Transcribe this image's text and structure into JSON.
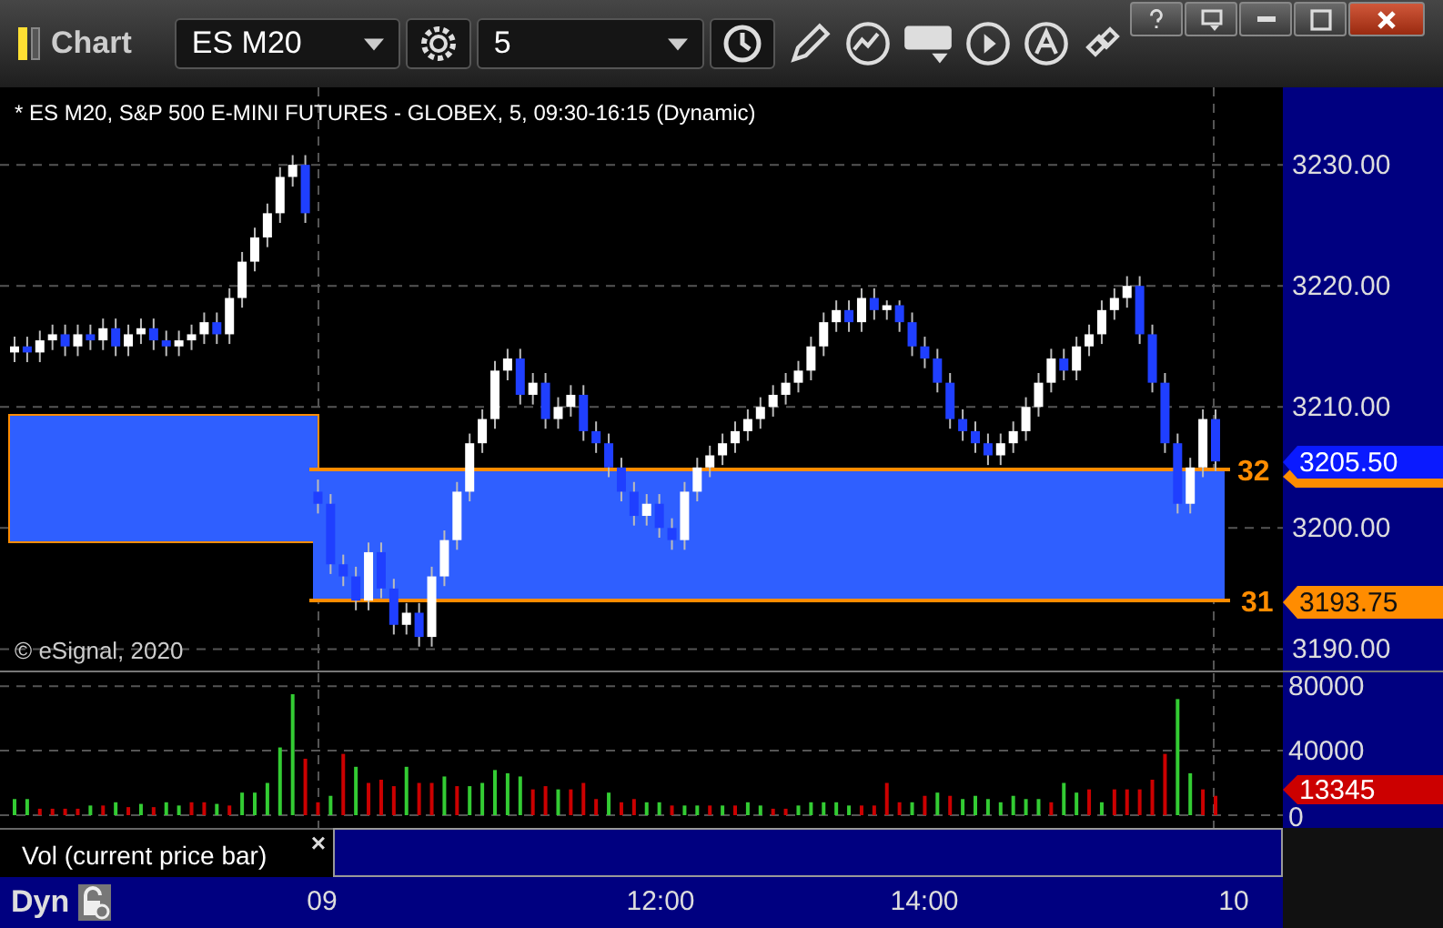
{
  "window": {
    "title": "Chart"
  },
  "toolbar": {
    "symbol": "ES M20",
    "interval": "5"
  },
  "price_pane": {
    "info": "* ES M20, S&P 500 E-MINI FUTURES - GLOBEX, 5, 09:30-16:15 (Dynamic)",
    "copyright": "© eSignal, 2020",
    "chart_data": {
      "type": "candlestick",
      "grid": true,
      "ylim": [
        3188,
        3236.4
      ],
      "yticks": [
        {
          "value": 3230,
          "label": "3230.00"
        },
        {
          "value": 3220,
          "label": "3220.00"
        },
        {
          "value": 3210,
          "label": "3210.00"
        },
        {
          "value": 3200,
          "label": "3200.00"
        },
        {
          "value": 3190,
          "label": "3190.00"
        }
      ],
      "ohlc": [
        [
          3214.5,
          3215.8,
          3213.7,
          3215
        ],
        [
          3215,
          3215.8,
          3213.7,
          3214.5
        ],
        [
          3214.5,
          3216.3,
          3213.7,
          3215.5
        ],
        [
          3215.5,
          3216.8,
          3214.7,
          3216
        ],
        [
          3216,
          3216.8,
          3214.2,
          3215
        ],
        [
          3215,
          3216.8,
          3214.2,
          3216
        ],
        [
          3216,
          3216.8,
          3214.7,
          3215.5
        ],
        [
          3215.5,
          3217.3,
          3214.7,
          3216.5
        ],
        [
          3216.5,
          3217.3,
          3214.2,
          3215
        ],
        [
          3215,
          3216.8,
          3214.2,
          3216
        ],
        [
          3216,
          3217.3,
          3215.2,
          3216.5
        ],
        [
          3216.5,
          3217.3,
          3214.7,
          3215.5
        ],
        [
          3215.5,
          3216.3,
          3214.2,
          3215
        ],
        [
          3215,
          3216.3,
          3214.2,
          3215.5
        ],
        [
          3215.5,
          3216.8,
          3214.7,
          3216
        ],
        [
          3216,
          3217.8,
          3215.2,
          3217
        ],
        [
          3217,
          3217.8,
          3215.2,
          3216
        ],
        [
          3216,
          3219.8,
          3215.2,
          3219
        ],
        [
          3219,
          3222.8,
          3218.2,
          3222
        ],
        [
          3222,
          3224.8,
          3221.2,
          3224
        ],
        [
          3224,
          3226.8,
          3223.2,
          3226
        ],
        [
          3226,
          3229.8,
          3225.2,
          3229
        ],
        [
          3229,
          3230.8,
          3228.2,
          3230
        ],
        [
          3230,
          3230.8,
          3225.2,
          3226
        ],
        [
          3203,
          3204,
          3201.2,
          3202
        ],
        [
          3202,
          3202.8,
          3196.2,
          3197
        ],
        [
          3197,
          3197.8,
          3195.2,
          3196
        ],
        [
          3196,
          3196.8,
          3193.2,
          3194
        ],
        [
          3194,
          3198.8,
          3193.2,
          3198
        ],
        [
          3198,
          3198.8,
          3194.2,
          3195
        ],
        [
          3195,
          3195.8,
          3191.2,
          3192
        ],
        [
          3192,
          3193.8,
          3191.2,
          3193
        ],
        [
          3193,
          3193.8,
          3190.2,
          3191
        ],
        [
          3191,
          3196.8,
          3190.2,
          3196
        ],
        [
          3196,
          3199.8,
          3195.2,
          3199
        ],
        [
          3199,
          3203.8,
          3198.2,
          3203
        ],
        [
          3203,
          3207.8,
          3202.2,
          3207
        ],
        [
          3207,
          3209.8,
          3206.2,
          3209
        ],
        [
          3209,
          3213.8,
          3208.2,
          3213
        ],
        [
          3213,
          3214.8,
          3212.2,
          3214
        ],
        [
          3214,
          3214.8,
          3210.2,
          3211
        ],
        [
          3211,
          3212.8,
          3210.2,
          3212
        ],
        [
          3212,
          3212.8,
          3208.2,
          3209
        ],
        [
          3209,
          3210.8,
          3208.2,
          3210
        ],
        [
          3210,
          3211.8,
          3209.2,
          3211
        ],
        [
          3211,
          3211.8,
          3207.2,
          3208
        ],
        [
          3208,
          3208.8,
          3206.2,
          3207
        ],
        [
          3207,
          3207.8,
          3204.2,
          3205
        ],
        [
          3205,
          3205.8,
          3202.2,
          3203
        ],
        [
          3203,
          3203.8,
          3200.2,
          3201
        ],
        [
          3201,
          3202.8,
          3200.2,
          3202
        ],
        [
          3202,
          3202.8,
          3199.2,
          3200
        ],
        [
          3200,
          3200.8,
          3198.2,
          3199
        ],
        [
          3199,
          3203.8,
          3198.2,
          3203
        ],
        [
          3203,
          3205.8,
          3202.2,
          3205
        ],
        [
          3205,
          3206.8,
          3204.2,
          3206
        ],
        [
          3206,
          3207.8,
          3205.2,
          3207
        ],
        [
          3207,
          3208.8,
          3206.2,
          3208
        ],
        [
          3208,
          3209.8,
          3207.2,
          3209
        ],
        [
          3209,
          3210.8,
          3208.2,
          3210
        ],
        [
          3210,
          3211.8,
          3209.2,
          3211
        ],
        [
          3211,
          3212.8,
          3210.2,
          3212
        ],
        [
          3212,
          3213.8,
          3211.2,
          3213
        ],
        [
          3213,
          3215.8,
          3212.2,
          3215
        ],
        [
          3215,
          3217.8,
          3214.2,
          3217
        ],
        [
          3217,
          3218.8,
          3216.2,
          3218
        ],
        [
          3218,
          3218.8,
          3216.2,
          3217
        ],
        [
          3217,
          3219.8,
          3216.2,
          3219
        ],
        [
          3219,
          3219.8,
          3217.2,
          3218
        ],
        [
          3218,
          3218.8,
          3217.2,
          3218.4
        ],
        [
          3218.4,
          3218.8,
          3216.2,
          3217
        ],
        [
          3217,
          3217.8,
          3214.2,
          3215
        ],
        [
          3215,
          3215.8,
          3213.2,
          3214
        ],
        [
          3214,
          3214.8,
          3211.2,
          3212
        ],
        [
          3212,
          3212.8,
          3208.2,
          3209
        ],
        [
          3209,
          3209.8,
          3207.2,
          3208
        ],
        [
          3208,
          3208.8,
          3206.2,
          3207
        ],
        [
          3207,
          3207.8,
          3205.2,
          3206
        ],
        [
          3206,
          3207.8,
          3205.2,
          3207
        ],
        [
          3207,
          3208.8,
          3206.2,
          3208
        ],
        [
          3208,
          3210.8,
          3207.2,
          3210
        ],
        [
          3210,
          3212.8,
          3209.2,
          3212
        ],
        [
          3212,
          3214.8,
          3211.2,
          3214
        ],
        [
          3214,
          3214.8,
          3212.2,
          3213
        ],
        [
          3213,
          3215.8,
          3212.2,
          3215
        ],
        [
          3215,
          3216.8,
          3214.2,
          3216
        ],
        [
          3216,
          3218.8,
          3215.2,
          3218
        ],
        [
          3218,
          3219.8,
          3217.2,
          3219
        ],
        [
          3219,
          3220.8,
          3218.2,
          3220
        ],
        [
          3220,
          3220.8,
          3215.2,
          3216
        ],
        [
          3216,
          3216.8,
          3211.2,
          3212
        ],
        [
          3212,
          3212.8,
          3206.2,
          3207
        ],
        [
          3207,
          3207.8,
          3201.2,
          3202
        ],
        [
          3202,
          3205.8,
          3201.2,
          3205
        ],
        [
          3205,
          3209.8,
          3204.2,
          3209
        ],
        [
          3209,
          3209.8,
          3204.7,
          3205.5
        ]
      ]
    },
    "zone_labels": [
      "32",
      "31"
    ],
    "last_price_tag": "3205.50",
    "level_tag": "3193.75"
  },
  "volume_pane": {
    "chart_data": {
      "type": "bar",
      "grid": true,
      "ylim": [
        0,
        88000
      ],
      "yticks": [
        0,
        40000,
        80000
      ],
      "series": [
        {
          "color": "#33cc33",
          "values": [
            10000,
            10000,
            null,
            null,
            null,
            null,
            6000,
            null,
            8000,
            null,
            7000,
            null,
            8000,
            6000,
            null,
            null,
            7000,
            null,
            14000,
            14000,
            20000,
            42000,
            75000,
            null,
            null,
            12000,
            null,
            30000,
            null,
            null,
            null,
            30000,
            null,
            null,
            24000,
            null,
            18000,
            20000,
            28000,
            26000,
            24000,
            null,
            null,
            16000,
            null,
            null,
            null,
            14000,
            null,
            null,
            8000,
            8000,
            null,
            6000,
            6000,
            null,
            6000,
            null,
            8000,
            6000,
            null,
            null,
            6000,
            8000,
            8000,
            8000,
            6000,
            null,
            null,
            null,
            null,
            8000,
            null,
            14000,
            null,
            10000,
            12000,
            10000,
            8000,
            12000,
            10000,
            10000,
            null,
            20000,
            14000,
            null,
            8000,
            null,
            null,
            null,
            null,
            null,
            72000,
            26000,
            null,
            null
          ]
        },
        {
          "color": "#cc0000",
          "values": [
            null,
            null,
            4000,
            4000,
            4000,
            4000,
            null,
            6000,
            null,
            5000,
            null,
            5000,
            null,
            null,
            8000,
            8000,
            null,
            6000,
            null,
            null,
            null,
            null,
            null,
            35000,
            8000,
            null,
            38000,
            null,
            20000,
            22000,
            18000,
            null,
            20000,
            20000,
            null,
            18000,
            null,
            null,
            null,
            null,
            null,
            16000,
            18000,
            null,
            16000,
            20000,
            10000,
            null,
            8000,
            10000,
            null,
            null,
            6000,
            null,
            null,
            6000,
            null,
            6000,
            null,
            null,
            4000,
            4000,
            null,
            null,
            null,
            null,
            null,
            6000,
            6000,
            20000,
            8000,
            null,
            12000,
            null,
            12000,
            null,
            null,
            null,
            null,
            null,
            null,
            null,
            8000,
            null,
            null,
            16000,
            null,
            16000,
            16000,
            16000,
            22000,
            38000,
            null,
            null,
            16000,
            12000
          ]
        }
      ]
    },
    "volume_tag": "13345",
    "legend": {
      "label": "Vol (current price bar)",
      "close": "×"
    }
  },
  "time_axis": {
    "mode": "Dyn",
    "labels": [
      "09",
      "12:00",
      "14:00",
      "10"
    ]
  }
}
